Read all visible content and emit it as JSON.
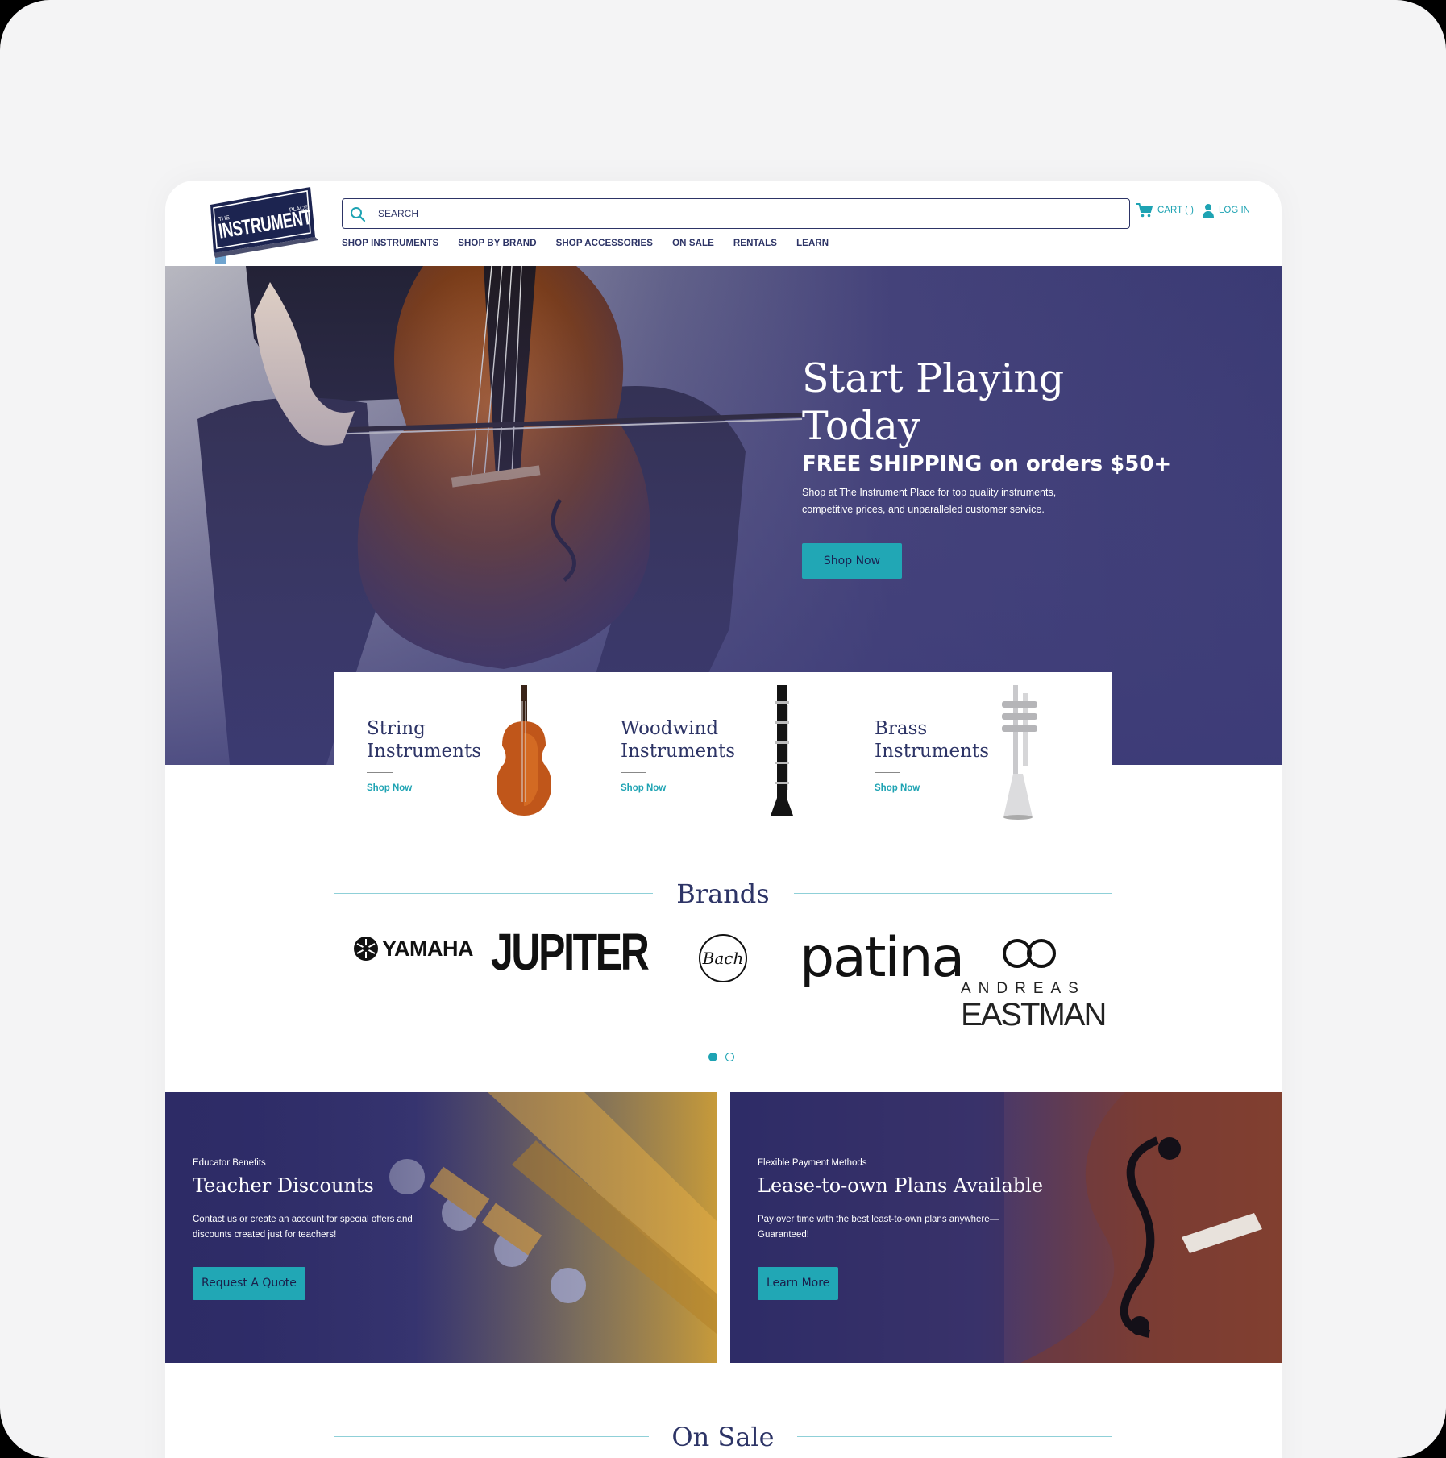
{
  "logo": {
    "text_the": "THE",
    "text_main": "INSTRUMENT",
    "text_place": "PLACE"
  },
  "search": {
    "placeholder": "SEARCH"
  },
  "utility": {
    "cart_label": "CART ( )",
    "login_label": "LOG IN"
  },
  "nav": [
    {
      "label": "SHOP INSTRUMENTS"
    },
    {
      "label": "SHOP BY BRAND"
    },
    {
      "label": "SHOP ACCESSORIES"
    },
    {
      "label": "ON SALE"
    },
    {
      "label": "RENTALS"
    },
    {
      "label": "LEARN"
    }
  ],
  "hero": {
    "title": "Start Playing Today",
    "subtitle": "FREE SHIPPING on orders $50+",
    "description": "Shop at The Instrument Place for top quality instruments, competitive prices, and unparalleled customer service.",
    "cta": "Shop Now"
  },
  "categories": [
    {
      "title": "String Instruments",
      "link": "Shop Now"
    },
    {
      "title": "Woodwind Instruments",
      "link": "Shop Now"
    },
    {
      "title": "Brass Instruments",
      "link": "Shop Now"
    }
  ],
  "brands": {
    "title": "Brands",
    "items": [
      "YAMAHA",
      "JUPITER",
      "Bach",
      "patina",
      "ANDREAS",
      "EASTMAN"
    ],
    "pagination": {
      "current": 1,
      "total": 2
    }
  },
  "promos": [
    {
      "kicker": "Educator Benefits",
      "title": "Teacher Discounts",
      "description": "Contact us or create an account for special offers and discounts created just for teachers!",
      "cta": "Request A Quote"
    },
    {
      "kicker": "Flexible Payment Methods",
      "title": "Lease-to-own Plans Available",
      "description": "Pay over time with the best least-to-own plans anywhere— Guaranteed!",
      "cta": "Learn More"
    }
  ],
  "on_sale": {
    "title": "On Sale"
  },
  "colors": {
    "navy": "#2d3466",
    "teal": "#1ea3b3",
    "hero_purple": "#3d3c78"
  }
}
